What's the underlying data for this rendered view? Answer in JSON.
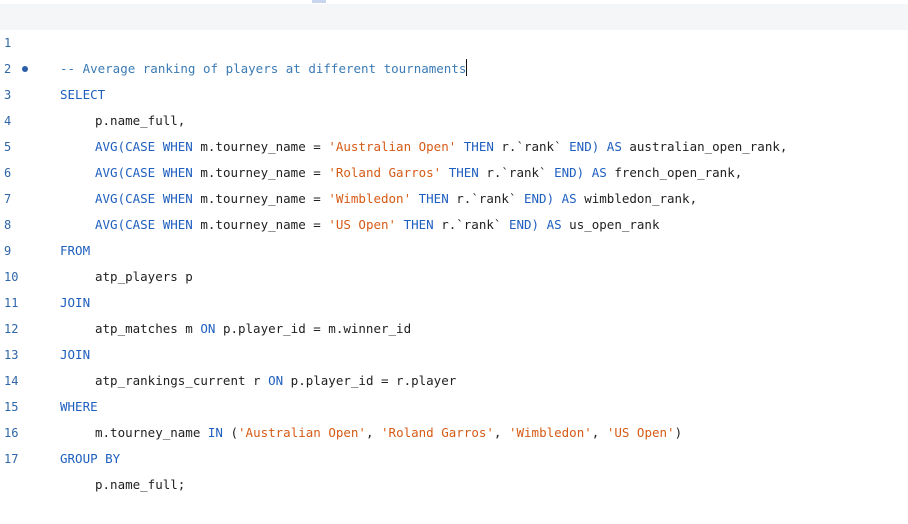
{
  "editor": {
    "lines": [
      {
        "n": "1",
        "t": [
          "-- Average ranking of players at different tournaments"
        ]
      },
      {
        "n": "2",
        "t": [
          "SELECT"
        ]
      },
      {
        "n": "3",
        "t": [
          "p.name_full,"
        ]
      },
      {
        "n": "4",
        "t": [
          "AVG(CASE WHEN",
          " m.tourney_name = ",
          "'Australian Open'",
          " THEN ",
          "r.`rank`",
          " END)",
          " AS",
          " australian_open_rank,"
        ]
      },
      {
        "n": "5",
        "t": [
          "AVG(CASE WHEN",
          " m.tourney_name = ",
          "'Roland Garros'",
          " THEN ",
          "r.`rank`",
          " END)",
          " AS",
          " french_open_rank,"
        ]
      },
      {
        "n": "6",
        "t": [
          "AVG(CASE WHEN",
          " m.tourney_name = ",
          "'Wimbledon'",
          " THEN ",
          "r.`rank`",
          " END)",
          " AS",
          " wimbledon_rank,"
        ]
      },
      {
        "n": "7",
        "t": [
          "AVG(CASE WHEN",
          " m.tourney_name = ",
          "'US Open'",
          " THEN ",
          "r.`rank`",
          " END)",
          " AS",
          " us_open_rank"
        ]
      },
      {
        "n": "8",
        "t": [
          "FROM"
        ]
      },
      {
        "n": "9",
        "t": [
          "atp_players p"
        ]
      },
      {
        "n": "10",
        "t": [
          "JOIN"
        ]
      },
      {
        "n": "11",
        "t": [
          "atp_matches m ",
          "ON",
          " p.player_id = m.winner_id"
        ]
      },
      {
        "n": "12",
        "t": [
          "JOIN"
        ]
      },
      {
        "n": "13",
        "t": [
          "atp_rankings_current r ",
          "ON",
          " p.player_id = r.player"
        ]
      },
      {
        "n": "14",
        "t": [
          "WHERE"
        ]
      },
      {
        "n": "15",
        "t": [
          "m.tourney_name ",
          "IN",
          " (",
          "'Australian Open'",
          ", ",
          "'Roland Garros'",
          ", ",
          "'Wimbledon'",
          ", ",
          "'US Open'",
          ")"
        ]
      },
      {
        "n": "16",
        "t": [
          "GROUP BY"
        ]
      },
      {
        "n": "17",
        "t": [
          "p.name_full;"
        ]
      }
    ]
  },
  "colors": {
    "keyword": "#1f5fbf",
    "string": "#d65b16",
    "comment": "#3b7bb5",
    "line_number": "#2f66a8"
  }
}
